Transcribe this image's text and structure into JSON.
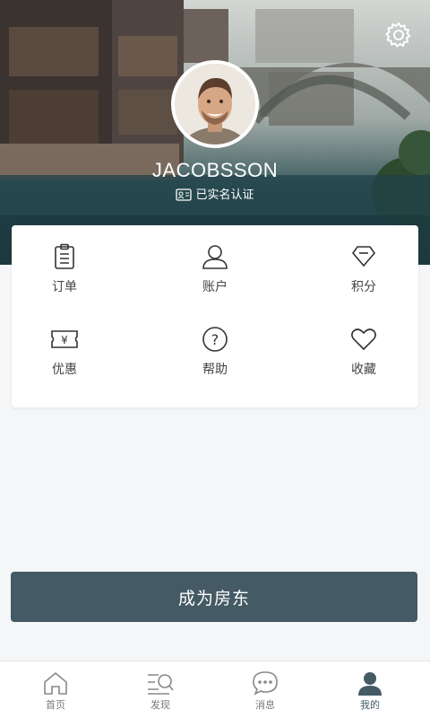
{
  "profile": {
    "username": "JACOBSSON",
    "verification_text": "已实名认证"
  },
  "menu": {
    "items": [
      {
        "label": "订单",
        "icon": "clipboard-icon"
      },
      {
        "label": "账户",
        "icon": "user-icon"
      },
      {
        "label": "积分",
        "icon": "diamond-icon"
      },
      {
        "label": "优惠",
        "icon": "coupon-icon"
      },
      {
        "label": "帮助",
        "icon": "help-icon"
      },
      {
        "label": "收藏",
        "icon": "heart-icon"
      }
    ]
  },
  "cta": {
    "label": "成为房东"
  },
  "bottom_nav": {
    "items": [
      {
        "label": "首页",
        "icon": "home-icon"
      },
      {
        "label": "发现",
        "icon": "discover-icon"
      },
      {
        "label": "消息",
        "icon": "message-icon"
      },
      {
        "label": "我的",
        "icon": "profile-icon",
        "active": true
      }
    ]
  },
  "colors": {
    "primary": "#445a64",
    "card_bg": "#ffffff",
    "page_bg": "#f4f6f7"
  }
}
